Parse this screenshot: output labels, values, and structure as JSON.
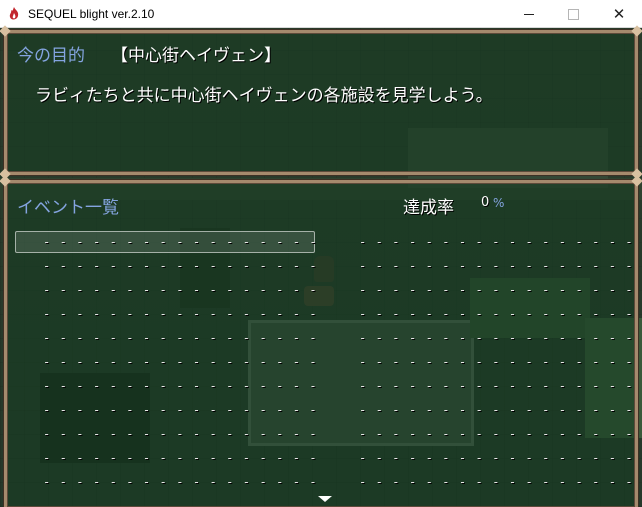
{
  "window": {
    "title": "SEQUEL blight ver.2.10",
    "icon": "app-flame-icon",
    "controls": [
      "minimize-icon",
      "maximize-icon",
      "close-icon"
    ]
  },
  "goal": {
    "label": "今の目的",
    "area": "【中心街ヘイヴェン】",
    "description": "ラビィたちと共に中心街ヘイヴェンの各施設を見学しよう。"
  },
  "events": {
    "label": "イベント一覧",
    "rate_label": "達成率",
    "rate_value": "0",
    "rate_unit": "%",
    "left_column": [
      "- - - - - - - - - - - - - - - - -",
      "- - - - - - - - - - - - - - - - -",
      "- - - - - - - - - - - - - - - - -",
      "- - - - - - - - - - - - - - - - -",
      "- - - - - - - - - - - - - - - - -",
      "- - - - - - - - - - - - - - - - -",
      "- - - - - - - - - - - - - - - - -",
      "- - - - - - - - - - - - - - - - -",
      "- - - - - - - - - - - - - - - - -",
      "- - - - - - - - - - - - - - - - -",
      "- - - - - - - - - - - - - - - - -"
    ],
    "right_column": [
      "- - - - - - - - - - - - - - - - -",
      "- - - - - - - - - - - - - - - - -",
      "- - - - - - - - - - - - - - - - -",
      "- - - - - - - - - - - - - - - - -",
      "- - - - - - - - - - - - - - - - -",
      "- - - - - - - - - - - - - - - - -",
      "- - - - - - - - - - - - - - - - -",
      "- - - - - - - - - - - - - - - - -",
      "- - - - - - - - - - - - - - - - -",
      "- - - - - - - - - - - - - - - - -",
      "- - - - - - - - - - - - - - - - -"
    ],
    "selected_index": 0
  },
  "colors": {
    "system_text": "#84a4e0",
    "window_frame": "#a58a6d"
  }
}
